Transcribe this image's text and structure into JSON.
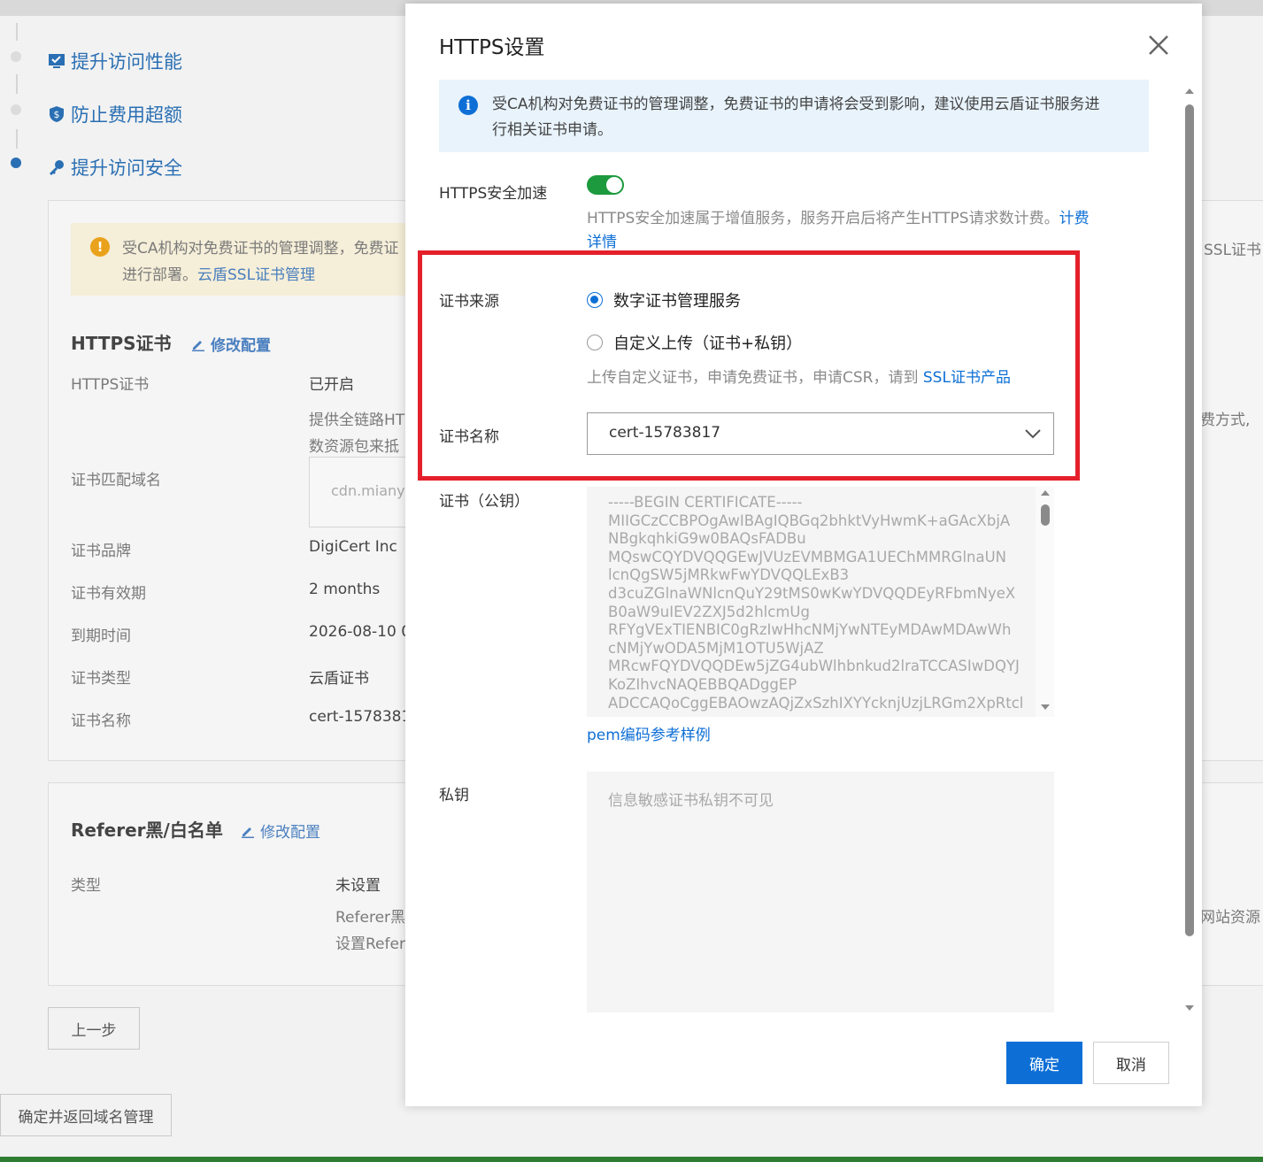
{
  "background": {
    "steps": [
      {
        "label": "提升访问性能"
      },
      {
        "label": "防止费用超额"
      },
      {
        "label": "提升访问安全"
      }
    ],
    "warning": {
      "line1": "受CA机构对免费证书的管理调整，免费证",
      "line2_prefix": "进行部署。",
      "line2_link": "云盾SSL证书管理"
    },
    "https_card": {
      "title": "HTTPS证书",
      "edit": "修改配置",
      "rows": [
        {
          "label": "HTTPS证书",
          "value": "已开启"
        },
        {
          "label": "证书匹配域名",
          "value": ""
        },
        {
          "label": "证书品牌",
          "value": "DigiCert Inc"
        },
        {
          "label": "证书有效期",
          "value": "2 months"
        },
        {
          "label": "到期时间",
          "value": "2026-08-10 0"
        },
        {
          "label": "证书类型",
          "value": "云盾证书"
        },
        {
          "label": "证书名称",
          "value": "cert-1578381"
        }
      ],
      "desc1": "提供全链路HT",
      "desc2": "数资源包来抵",
      "domain_input": "cdn.miany",
      "right_fragment1": "SSL证书",
      "right_fragment2": "费方式,"
    },
    "referer_card": {
      "title": "Referer黑/白名单",
      "edit": "修改配置",
      "type_label": "类型",
      "type_value": "未设置",
      "desc1": "Referer黑",
      "desc2": "设置Refer",
      "right_fragment": "网站资源"
    },
    "prev_button": "上一步",
    "confirm_return_button": "确定并返回域名管理"
  },
  "dialog": {
    "title": "HTTPS设置",
    "info": "受CA机构对免费证书的管理调整，免费证书的申请将会受到影响，建议使用云盾证书服务进行相关证书申请。",
    "https_accel": {
      "label": "HTTPS安全加速",
      "enabled": true,
      "help_prefix": "HTTPS安全加速属于增值服务，服务开启后将产生HTTPS请求数计费。",
      "help_link1": "计费",
      "help_link2": "详情"
    },
    "cert_source": {
      "label": "证书来源",
      "options": [
        "数字证书管理服务",
        "自定义上传（证书+私钥）"
      ],
      "selected": 0,
      "help_prefix": "上传自定义证书，申请免费证书，申请CSR，请到 ",
      "help_link": "SSL证书产品"
    },
    "cert_name": {
      "label": "证书名称",
      "value": "cert-15783817"
    },
    "public_key": {
      "label": "证书（公钥）",
      "content": "-----BEGIN CERTIFICATE-----\nMIIGCzCCBPOgAwIBAgIQBGq2bhktVyHwmK+aGAcXbjA\nNBgkqhkiG9w0BAQsFADBu\nMQswCQYDVQQGEwJVUzEVMBMGA1UEChMMRGlnaUN\nlcnQgSW5jMRkwFwYDVQQLExB3\nd3cuZGlnaWNlcnQuY29tMS0wKwYDVQQDEyRFbmNyeX\nB0aW9uIEV2ZXJ5d2hlcmUg\nRFYgVExTIENBIC0gRzIwHhcNMjYwNTEyMDAwMDAwWh\ncNMjYwODA5MjM1OTU5WjAZ\nMRcwFQYDVQQDEw5jZG4ubWlhbnkud2lraTCCASIwDQYJ\nKoZIhvcNAQEBBQADggEP\nADCCAQoCggEBAOwzAQjZxSzhIXYYcknjUzjLRGm2XpRtcl",
      "pem_link": "pem编码参考样例"
    },
    "private_key": {
      "label": "私钥",
      "placeholder": "信息敏感证书私钥不可见"
    },
    "ok": "确定",
    "cancel": "取消"
  }
}
